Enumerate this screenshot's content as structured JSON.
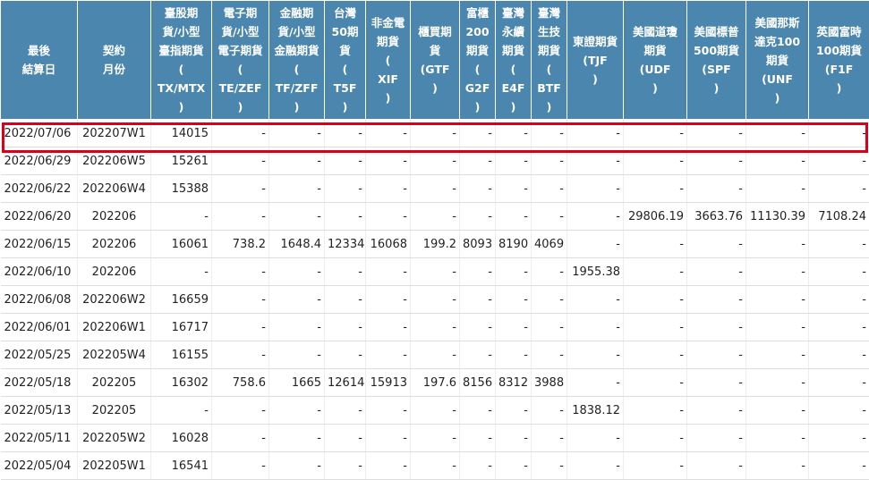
{
  "table": {
    "headers": [
      [
        "最後",
        "結算日"
      ],
      [
        "契約",
        "月份"
      ],
      [
        "臺股期",
        "貨/小型",
        "臺指期貨",
        "(",
        "TX/MTX",
        ")"
      ],
      [
        "電子期",
        "貨/小型",
        "電子期貨",
        "(",
        "TE/ZEF",
        ")"
      ],
      [
        "金融期",
        "貨/小型",
        "金融期貨",
        "(",
        "TF/ZFF",
        ")"
      ],
      [
        "台灣",
        "50期",
        "貨",
        "(",
        "T5F",
        ")"
      ],
      [
        "非金電",
        "期貨",
        "(",
        "XIF",
        ")"
      ],
      [
        "櫃買期",
        "貨",
        "(GTF",
        ")"
      ],
      [
        "富櫃",
        "200",
        "期貨",
        "(",
        "G2F",
        ")"
      ],
      [
        "臺灣",
        "永續",
        "期貨",
        "(",
        "E4F",
        ")"
      ],
      [
        "臺灣",
        "生技",
        "期貨",
        "(",
        "BTF",
        ")"
      ],
      [
        "東證期貨",
        "(TJF",
        ")"
      ],
      [
        "美國道瓊",
        "期貨",
        "(UDF",
        ")"
      ],
      [
        "美國標普",
        "500期貨",
        "(SPF",
        ")"
      ],
      [
        "美國那斯",
        "達克100",
        "期貨",
        "(UNF",
        ")"
      ],
      [
        "英國富時",
        "100期貨",
        "(F1F",
        ")"
      ]
    ],
    "rows": [
      [
        "2022/07/06",
        "202207W1",
        "14015",
        "-",
        "-",
        "-",
        "-",
        "-",
        "-",
        "-",
        "-",
        "-",
        "-",
        "-",
        "-",
        "-"
      ],
      [
        "2022/06/29",
        "202206W5",
        "15261",
        "-",
        "-",
        "-",
        "-",
        "-",
        "-",
        "-",
        "-",
        "-",
        "-",
        "-",
        "-",
        "-"
      ],
      [
        "2022/06/22",
        "202206W4",
        "15388",
        "-",
        "-",
        "-",
        "-",
        "-",
        "-",
        "-",
        "-",
        "-",
        "-",
        "-",
        "-",
        "-"
      ],
      [
        "2022/06/20",
        "202206",
        "-",
        "-",
        "-",
        "-",
        "-",
        "-",
        "-",
        "-",
        "-",
        "-",
        "29806.19",
        "3663.76",
        "11130.39",
        "7108.24"
      ],
      [
        "2022/06/15",
        "202206",
        "16061",
        "738.2",
        "1648.4",
        "12334",
        "16068",
        "199.2",
        "8093",
        "8190",
        "4069",
        "-",
        "-",
        "-",
        "-",
        "-"
      ],
      [
        "2022/06/10",
        "202206",
        "-",
        "-",
        "-",
        "-",
        "-",
        "-",
        "-",
        "-",
        "-",
        "1955.38",
        "-",
        "-",
        "-",
        "-"
      ],
      [
        "2022/06/08",
        "202206W2",
        "16659",
        "-",
        "-",
        "-",
        "-",
        "-",
        "-",
        "-",
        "-",
        "-",
        "-",
        "-",
        "-",
        "-"
      ],
      [
        "2022/06/01",
        "202206W1",
        "16717",
        "-",
        "-",
        "-",
        "-",
        "-",
        "-",
        "-",
        "-",
        "-",
        "-",
        "-",
        "-",
        "-"
      ],
      [
        "2022/05/25",
        "202205W4",
        "16155",
        "-",
        "-",
        "-",
        "-",
        "-",
        "-",
        "-",
        "-",
        "-",
        "-",
        "-",
        "-",
        "-"
      ],
      [
        "2022/05/18",
        "202205",
        "16302",
        "758.6",
        "1665",
        "12614",
        "15913",
        "197.6",
        "8156",
        "8312",
        "3988",
        "-",
        "-",
        "-",
        "-",
        "-"
      ],
      [
        "2022/05/13",
        "202205",
        "-",
        "-",
        "-",
        "-",
        "-",
        "-",
        "-",
        "-",
        "-",
        "1838.12",
        "-",
        "-",
        "-",
        "-"
      ],
      [
        "2022/05/11",
        "202205W2",
        "16028",
        "-",
        "-",
        "-",
        "-",
        "-",
        "-",
        "-",
        "-",
        "-",
        "-",
        "-",
        "-",
        "-"
      ],
      [
        "2022/05/04",
        "202205W1",
        "16541",
        "-",
        "-",
        "-",
        "-",
        "-",
        "-",
        "-",
        "-",
        "-",
        "-",
        "-",
        "-",
        "-"
      ]
    ]
  },
  "colors": {
    "header_bg": "#4a86ad",
    "header_text": "#ffffff",
    "highlight": "#d9001b"
  }
}
